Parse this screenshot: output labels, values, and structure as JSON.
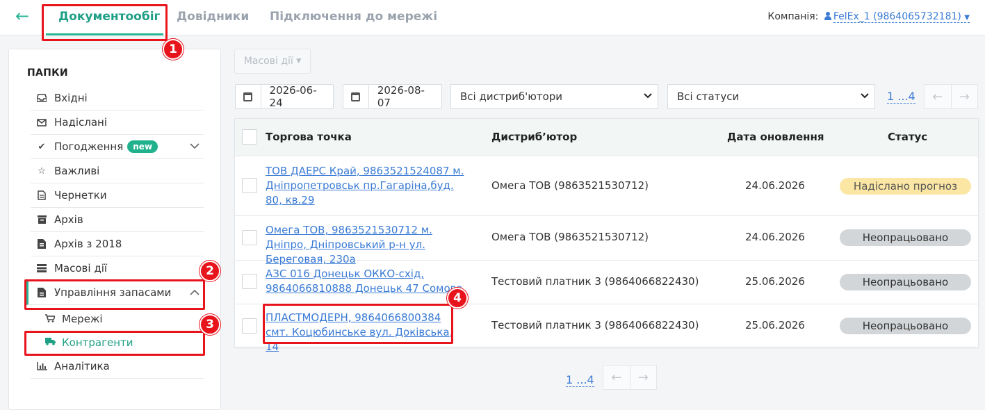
{
  "header": {
    "back_icon": "arrow-left-icon",
    "tabs": [
      {
        "label": "Документообіг",
        "active": true
      },
      {
        "label": "Довідники",
        "active": false
      },
      {
        "label": "Підключення до мережі",
        "active": false
      }
    ],
    "company_label": "Компанія:",
    "company_value": "FelEx_1 (9864065732181)"
  },
  "sidebar": {
    "title": "ПАПКИ",
    "items": [
      {
        "label": "Вхідні",
        "icon": "inbox-icon"
      },
      {
        "label": "Надіслані",
        "icon": "envelope-icon"
      },
      {
        "label": "Погодження",
        "icon": "check-icon",
        "badge": "new"
      },
      {
        "label": "Важливі",
        "icon": "star-icon"
      },
      {
        "label": "Чернетки",
        "icon": "file-icon"
      },
      {
        "label": "Архів",
        "icon": "archive-icon"
      },
      {
        "label": "Архів з 2018",
        "icon": "file-archive-icon"
      },
      {
        "label": "Масові дії",
        "icon": "stack-icon"
      },
      {
        "label": "Управління запасами",
        "icon": "file-icon"
      },
      {
        "label": "Мережі",
        "icon": "cart-icon"
      },
      {
        "label": "Контрагенти",
        "icon": "truck-icon"
      },
      {
        "label": "Аналітика",
        "icon": "bar-chart-icon"
      }
    ]
  },
  "toolbar": {
    "mass_actions": "Масові дії",
    "date_from": "2026-06-24",
    "date_to": "2026-08-07",
    "distributor_select": "Всі дистриб'ютори",
    "status_select": "Всі статуси",
    "pager": "1 ...4"
  },
  "table": {
    "headers": {
      "point": "Торгова точка",
      "distributor": "Дистриб’ютор",
      "date": "Дата оновлення",
      "status": "Статус"
    },
    "rows": [
      {
        "point": "ТОВ ДАЕРС Край, 9863521524087 м. Дніпропетровськ пр.Гагаріна,буд. 80, кв.29",
        "distributor": "Омега ТОВ (9863521530712)",
        "date": "24.06.2026",
        "status": "Надіслано прогноз"
      },
      {
        "point": "Омега ТОВ, 9863521530712 м. Дніпро, Дніпровський р-н ул. Береговая, 230а",
        "distributor": "Омега ТОВ (9863521530712)",
        "date": "24.06.2026",
        "status": "Неопрацьовано"
      },
      {
        "point": "АЗС 016 Донецьк ОККО-схід, 9864066810888 Донецьк 47 Сомова",
        "distributor": "Тестовий платник 3 (9864066822430)",
        "date": "25.06.2026",
        "status": "Неопрацьовано"
      },
      {
        "point": "ПЛАСТМОДЕРН, 9864066800384 смт. Коцюбинське вул. Доківська, 14",
        "distributor": "Тестовий платник 3 (9864066822430)",
        "date": "25.06.2026",
        "status": "Неопрацьовано"
      }
    ]
  },
  "bottom_pager": "1 ...4",
  "annotations": [
    "1",
    "2",
    "3",
    "4"
  ],
  "colors": {
    "accent": "#2ab594",
    "highlight": "#e8141c",
    "link": "#3a7bd5"
  }
}
